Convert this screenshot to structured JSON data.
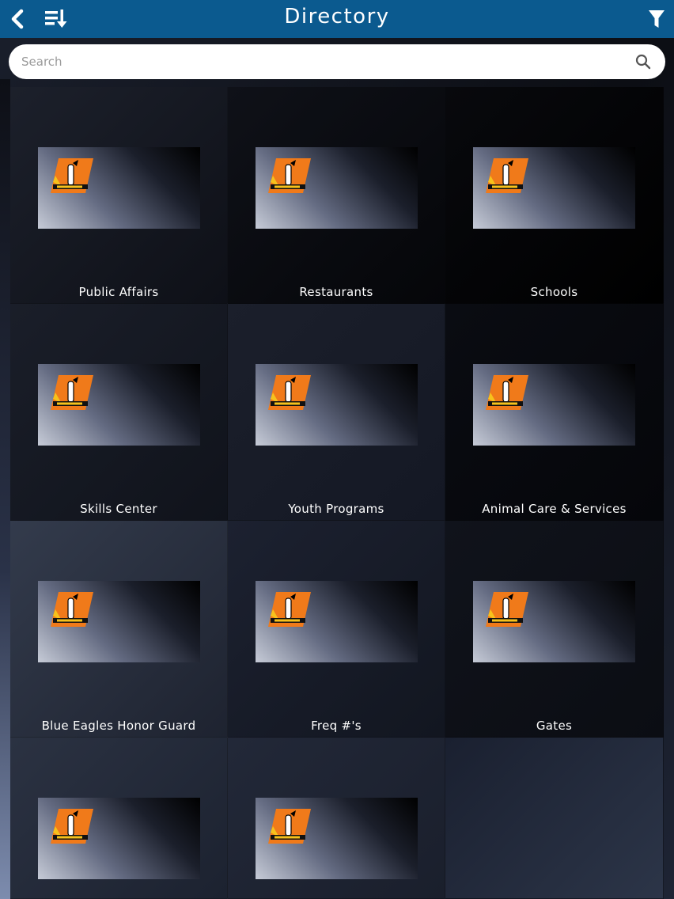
{
  "header": {
    "title": "Directory",
    "back_icon": "back-chevron-icon",
    "sort_icon": "sort-list-icon",
    "filter_icon": "filter-funnel-icon",
    "color": "#0b5a8f"
  },
  "search": {
    "placeholder": "Search",
    "value": "",
    "icon": "search-icon"
  },
  "tiles": [
    {
      "label": "Public Affairs"
    },
    {
      "label": "Restaurants"
    },
    {
      "label": "Schools"
    },
    {
      "label": "Skills Center"
    },
    {
      "label": "Youth Programs"
    },
    {
      "label": "Animal Care & Services"
    },
    {
      "label": "Blue Eagles Honor Guard"
    },
    {
      "label": "Freq #'s"
    },
    {
      "label": "Gates"
    },
    {
      "label": ""
    },
    {
      "label": ""
    }
  ],
  "colors": {
    "accent": "#0b5a8f",
    "logo_orange": "#f07a1a",
    "logo_yellow": "#f6c21c"
  }
}
